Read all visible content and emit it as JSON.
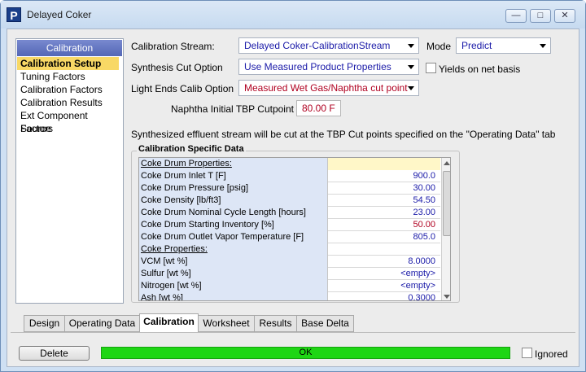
{
  "window": {
    "title": "Delayed Coker",
    "app_icon_letter": "P"
  },
  "nav": {
    "header": "Calibration",
    "items": [
      {
        "label": "Calibration Setup",
        "active": true
      },
      {
        "label": "Tuning Factors"
      },
      {
        "label": "Calibration Factors"
      },
      {
        "label": "Calibration Results"
      },
      {
        "label": "Ext Component Factors"
      },
      {
        "label": "Source"
      }
    ]
  },
  "form": {
    "calibration_stream": {
      "label": "Calibration Stream:",
      "value": "Delayed Coker-CalibrationStream"
    },
    "mode": {
      "label": "Mode",
      "value": "Predict"
    },
    "synthesis_cut": {
      "label": "Synthesis Cut Option",
      "value": "Use Measured Product Properties"
    },
    "yields_net": {
      "label": "Yields on net basis",
      "checked": false
    },
    "light_ends": {
      "label": "Light Ends Calib Option",
      "value": "Measured Wet Gas/Naphtha cut point"
    },
    "naphtha_tbp": {
      "label": "Naphtha Initial TBP Cutpoint",
      "value": "80.00 F"
    },
    "note": "Synthesized effluent stream will be cut at the TBP Cut points specified on the \"Operating Data\" tab"
  },
  "specific": {
    "title": "Calibration Specific Data",
    "rows": [
      {
        "name": "Coke Drum Properties:",
        "value": "",
        "header": true
      },
      {
        "name": "Coke Drum Inlet T [F]",
        "value": "900.0",
        "color": "blue"
      },
      {
        "name": "Coke Drum Pressure [psig]",
        "value": "30.00",
        "color": "blue"
      },
      {
        "name": "Coke Density [lb/ft3]",
        "value": "54.50",
        "color": "blue"
      },
      {
        "name": "Coke Drum Nominal Cycle Length [hours]",
        "value": "23.00",
        "color": "blue"
      },
      {
        "name": "Coke Drum Starting Inventory [%]",
        "value": "50.00",
        "color": "red"
      },
      {
        "name": "Coke Drum Outlet Vapor Temperature [F]",
        "value": "805.0",
        "color": "blue"
      },
      {
        "name": "Coke Properties:",
        "value": "",
        "header": true
      },
      {
        "name": "VCM [wt %]",
        "value": "8.0000",
        "color": "blue"
      },
      {
        "name": "Sulfur [wt %]",
        "value": "<empty>",
        "color": "blue"
      },
      {
        "name": "Nitrogen [wt %]",
        "value": "<empty>",
        "color": "blue"
      },
      {
        "name": "Ash [wt %]",
        "value": "0.3000",
        "color": "blue"
      }
    ]
  },
  "tabs": [
    "Design",
    "Operating Data",
    "Calibration",
    "Worksheet",
    "Results",
    "Base Delta"
  ],
  "active_tab": "Calibration",
  "footer": {
    "delete_label": "Delete",
    "status": "OK",
    "ignored_label": "Ignored",
    "ignored_checked": false
  },
  "colors": {
    "status_ok": "#1ed614",
    "nav_active": "#f8d865",
    "nav_header": "#5467b6"
  },
  "icons": {
    "minimize": "minimize-icon",
    "maximize": "maximize-icon",
    "close": "close-icon"
  }
}
